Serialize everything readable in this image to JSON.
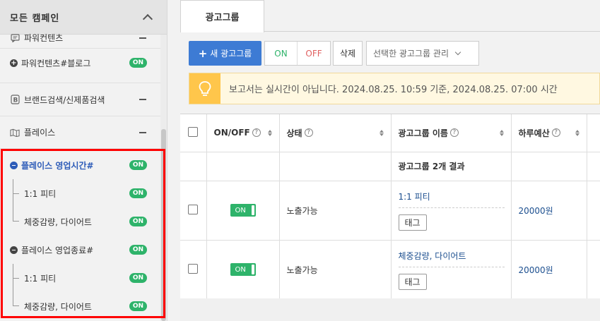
{
  "sidebar": {
    "header_title": "모든 캠페인",
    "items": [
      {
        "label": "파워컨텐츠"
      },
      {
        "label": "파워컨텐츠#블로그",
        "status": "ON"
      },
      {
        "label": "브랜드검색/신제품검색"
      },
      {
        "label": "플레이스"
      }
    ],
    "groups": [
      {
        "label": "플레이스 영업시간#",
        "status": "ON",
        "children": [
          {
            "label": "1:1 피티",
            "status": "ON"
          },
          {
            "label": "체중감량, 다이어트",
            "status": "ON"
          }
        ]
      },
      {
        "label": "플레이스 영업종료#",
        "status": "ON",
        "children": [
          {
            "label": "1:1 피티",
            "status": "ON"
          },
          {
            "label": "체중감량, 다이어트",
            "status": "ON"
          }
        ]
      }
    ]
  },
  "tabs": {
    "active": "광고그룹"
  },
  "toolbar": {
    "new_label": "새 광고그룹",
    "on_label": "ON",
    "off_label": "OFF",
    "delete_label": "삭제",
    "manage_placeholder": "선택한 광고그룹 관리"
  },
  "notice": {
    "text": "보고서는 실시간이 아닙니다. 2024.08.25. 10:59 기준, 2024.08.25. 07:00 시간"
  },
  "table": {
    "headers": {
      "onoff": "ON/OFF",
      "status": "상태",
      "name": "광고그룹 이름",
      "budget": "하루예산"
    },
    "summary": "광고그룹 2개 결과",
    "rows": [
      {
        "toggle": "ON",
        "status": "노출가능",
        "name": "1:1 피티",
        "tag": "태그",
        "budget": "20000원"
      },
      {
        "toggle": "ON",
        "status": "노출가능",
        "name": "체중감량, 다이어트",
        "tag": "태그",
        "budget": "20000원"
      }
    ]
  },
  "colors": {
    "on_green": "#2eb36a",
    "accent_blue": "#3d7bd4",
    "highlight_red": "#ff0000",
    "notice_yellow": "#ffc64b"
  }
}
